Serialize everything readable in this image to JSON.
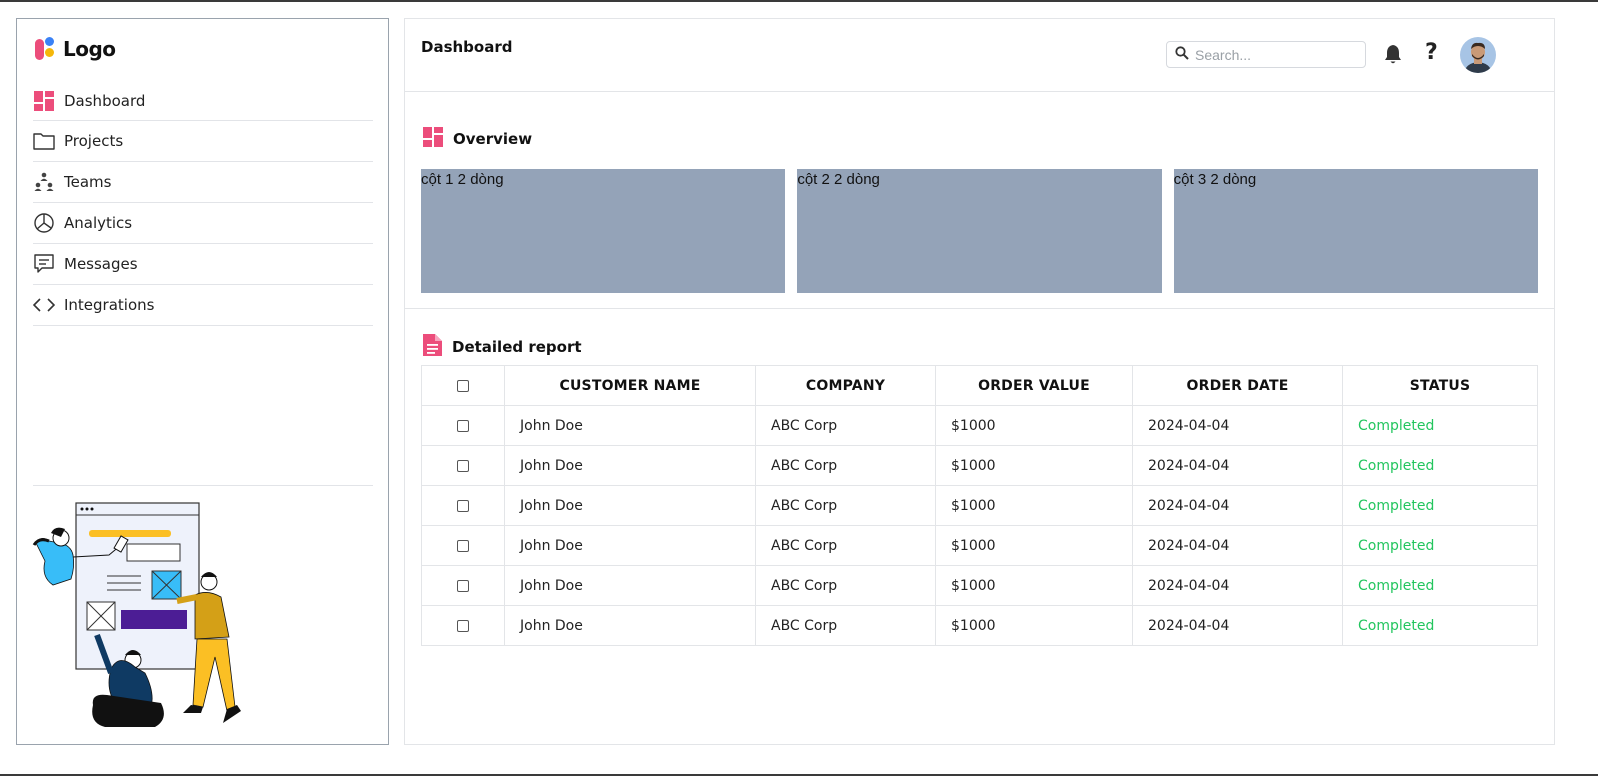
{
  "brand": {
    "logo_text": "Logo"
  },
  "sidebar": {
    "items": [
      {
        "label": "Dashboard",
        "icon": "dashboard-icon"
      },
      {
        "label": "Projects",
        "icon": "folder-icon"
      },
      {
        "label": "Teams",
        "icon": "teams-icon"
      },
      {
        "label": "Analytics",
        "icon": "pie-chart-icon"
      },
      {
        "label": "Messages",
        "icon": "message-icon"
      },
      {
        "label": "Integrations",
        "icon": "code-icon"
      }
    ]
  },
  "header": {
    "title": "Dashboard",
    "search_placeholder": "Search...",
    "help_glyph": "?"
  },
  "overview": {
    "title": "Overview",
    "cards": [
      "cột 1 2 dòng",
      "cột 2 2 dòng",
      "cột 3 2 dòng"
    ]
  },
  "report": {
    "title": "Detailed report",
    "columns": [
      "CUSTOMER NAME",
      "COMPANY",
      "ORDER VALUE",
      "ORDER DATE",
      "STATUS"
    ],
    "rows": [
      {
        "customer": "John Doe",
        "company": "ABC Corp",
        "value": "$1000",
        "date": "2024-04-04",
        "status": "Completed"
      },
      {
        "customer": "John Doe",
        "company": "ABC Corp",
        "value": "$1000",
        "date": "2024-04-04",
        "status": "Completed"
      },
      {
        "customer": "John Doe",
        "company": "ABC Corp",
        "value": "$1000",
        "date": "2024-04-04",
        "status": "Completed"
      },
      {
        "customer": "John Doe",
        "company": "ABC Corp",
        "value": "$1000",
        "date": "2024-04-04",
        "status": "Completed"
      },
      {
        "customer": "John Doe",
        "company": "ABC Corp",
        "value": "$1000",
        "date": "2024-04-04",
        "status": "Completed"
      },
      {
        "customer": "John Doe",
        "company": "ABC Corp",
        "value": "$1000",
        "date": "2024-04-04",
        "status": "Completed"
      }
    ]
  },
  "colors": {
    "accent": "#ec4d7b",
    "card": "#94a3b8",
    "status_completed": "#22c55e"
  }
}
